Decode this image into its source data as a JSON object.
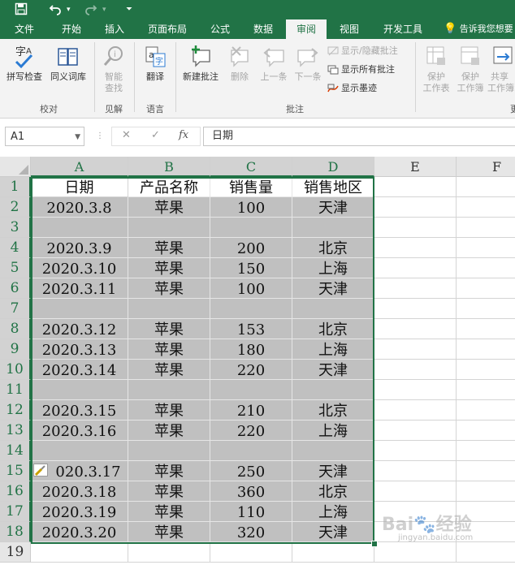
{
  "qat": {
    "save_icon": "save-icon",
    "undo_icon": "undo-icon",
    "redo_icon": "redo-icon",
    "customize_icon": "customize-icon"
  },
  "tabs": [
    {
      "label": "文件"
    },
    {
      "label": "开始"
    },
    {
      "label": "插入"
    },
    {
      "label": "页面布局"
    },
    {
      "label": "公式"
    },
    {
      "label": "数据"
    },
    {
      "label": "审阅",
      "active": true
    },
    {
      "label": "视图"
    },
    {
      "label": "开发工具"
    }
  ],
  "tell_me": "告诉我您想要",
  "ribbon": {
    "proofing": {
      "spell": "拼写检查",
      "thesaurus": "同义词库",
      "group": "校对"
    },
    "insights": {
      "smart_lookup_1": "智能",
      "smart_lookup_2": "查找",
      "group": "见解"
    },
    "language": {
      "translate": "翻译",
      "group": "语言"
    },
    "comments": {
      "new": "新建批注",
      "delete": "删除",
      "prev": "上一条",
      "next": "下一条",
      "show_hide": "显示/隐藏批注",
      "show_all": "显示所有批注",
      "show_ink": "显示墨迹",
      "group": "批注"
    },
    "changes": {
      "protect_sheet_1": "保护",
      "protect_sheet_2": "工作表",
      "protect_book_1": "保护",
      "protect_book_2": "工作簿",
      "share_1": "共享",
      "share_2": "工作簿",
      "group_partial": "更"
    }
  },
  "formula_bar": {
    "name_box": "A1",
    "fx": "fx",
    "content": "日期"
  },
  "columns": [
    "A",
    "B",
    "C",
    "D",
    "E",
    "F"
  ],
  "rows": [
    {
      "n": "1",
      "cells": [
        "日期",
        "产品名称",
        "销售量",
        "销售地区"
      ]
    },
    {
      "n": "2",
      "cells": [
        "2020.3.8",
        "苹果",
        "100",
        "天津"
      ]
    },
    {
      "n": "3",
      "cells": [
        "",
        "",
        "",
        ""
      ]
    },
    {
      "n": "4",
      "cells": [
        "2020.3.9",
        "苹果",
        "200",
        "北京"
      ]
    },
    {
      "n": "5",
      "cells": [
        "2020.3.10",
        "苹果",
        "150",
        "上海"
      ]
    },
    {
      "n": "6",
      "cells": [
        "2020.3.11",
        "苹果",
        "100",
        "天津"
      ]
    },
    {
      "n": "7",
      "cells": [
        "",
        "",
        "",
        ""
      ]
    },
    {
      "n": "8",
      "cells": [
        "2020.3.12",
        "苹果",
        "153",
        "北京"
      ]
    },
    {
      "n": "9",
      "cells": [
        "2020.3.13",
        "苹果",
        "180",
        "上海"
      ]
    },
    {
      "n": "10",
      "cells": [
        "2020.3.14",
        "苹果",
        "220",
        "天津"
      ]
    },
    {
      "n": "11",
      "cells": [
        "",
        "",
        "",
        ""
      ]
    },
    {
      "n": "12",
      "cells": [
        "2020.3.15",
        "苹果",
        "210",
        "北京"
      ]
    },
    {
      "n": "13",
      "cells": [
        "2020.3.16",
        "苹果",
        "220",
        "上海"
      ]
    },
    {
      "n": "14",
      "cells": [
        "",
        "",
        "",
        ""
      ]
    },
    {
      "n": "15",
      "cells": [
        "020.3.17",
        "苹果",
        "250",
        "天津"
      ]
    },
    {
      "n": "16",
      "cells": [
        "2020.3.18",
        "苹果",
        "360",
        "北京"
      ]
    },
    {
      "n": "17",
      "cells": [
        "2020.3.19",
        "苹果",
        "110",
        "上海"
      ]
    },
    {
      "n": "18",
      "cells": [
        "2020.3.20",
        "苹果",
        "320",
        "天津"
      ]
    },
    {
      "n": "19",
      "cells": [
        "",
        "",
        "",
        ""
      ]
    }
  ],
  "quick_analysis_icon": "quick-analysis-icon",
  "watermark": {
    "brand": "Bai",
    "brand2": "经验",
    "url": "jingyan.baidu.com"
  },
  "colors": {
    "accent": "#217346",
    "selection_fill": "#c0c0c0"
  }
}
